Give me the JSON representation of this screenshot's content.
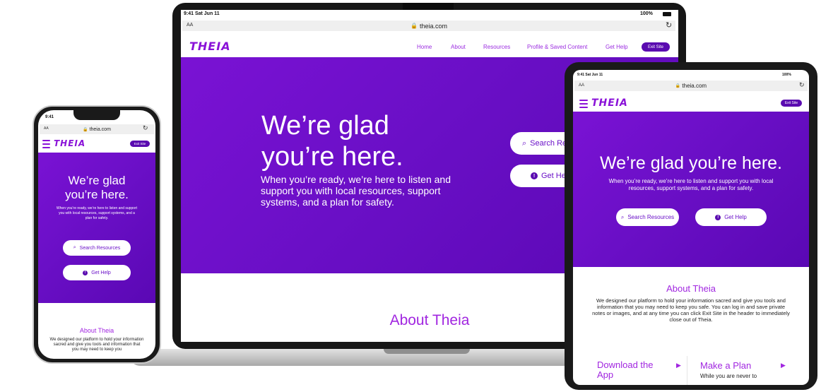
{
  "brand": {
    "logo": "THEIA",
    "primary": "#6a0fc6",
    "accent": "#a126e0",
    "dark": "#5a0bb0"
  },
  "laptop": {
    "status_time": "9:41 Sat Jun 11",
    "status_battery": "100%",
    "text_size": "AA",
    "url": "theia.com",
    "nav": [
      "Home",
      "About",
      "Resources",
      "Profile & Saved Content",
      "Get Help"
    ],
    "exit": "Exit Site",
    "headline": "We’re glad you’re here.",
    "subtext": "When you’re ready, we’re here to listen and support you with local resources, support systems, and a plan for safety.",
    "search_button": "Search Res",
    "help_button": "Get He",
    "about_title": "About Theia"
  },
  "tablet": {
    "status_time": "9:41 Sat Jun 11",
    "status_battery": "100%",
    "text_size": "AA",
    "url": "theia.com",
    "exit": "Exit Site",
    "headline": "We’re glad you’re here.",
    "subtext": "When you’re ready, we’re here to listen and support you with local resources, support systems, and a plan for safety.",
    "search_button": "Search Resources",
    "help_button": "Get Help",
    "about_title": "About Theia",
    "about_text": "We designed our platform to hold your information sacred and give you tools and information that you may need to keep you safe. You can log in and save private notes or images, and at any time you can click Exit Site in the header to immediately close out of Theia.",
    "card1_title": "Download the App",
    "card2_title": "Make a Plan",
    "card2_text": "While you are never to"
  },
  "phone": {
    "status_time": "9:41",
    "text_size": "AA",
    "url": "theia.com",
    "exit": "Exit Site",
    "headline": "We’re glad you’re here.",
    "subtext": "When you’re ready, we’re here to listen and support you with local resources, support systems, and a plan for safety.",
    "search_button": "Search Resources",
    "help_button": "Get Help",
    "about_title": "About Theia",
    "about_text": "We designed our platform to hold your information sacred and give you tools and information that you may need to keep you"
  }
}
